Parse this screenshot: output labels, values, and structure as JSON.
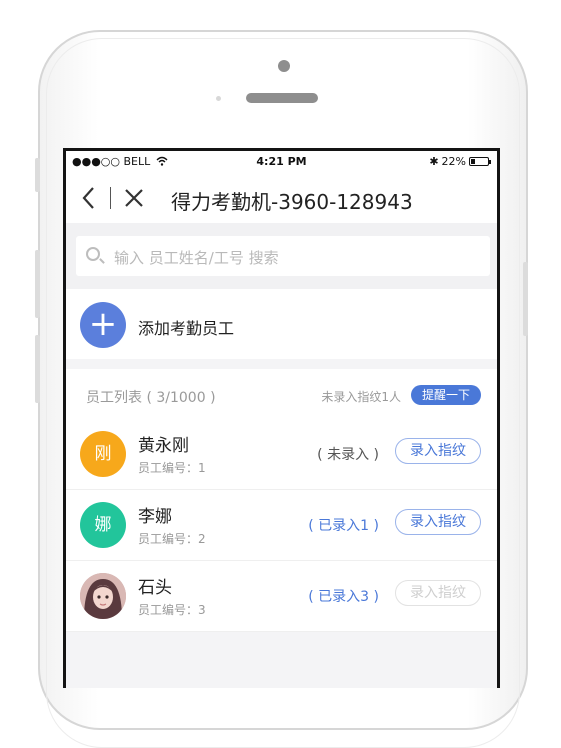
{
  "status_bar": {
    "carrier": "●●●○○ BELL",
    "time": "4:21 PM",
    "bluetooth": "✱",
    "battery_text": "22%",
    "battery_level": 0.22
  },
  "nav": {
    "title": "得力考勤机-3960-128943"
  },
  "search": {
    "placeholder": "输入 员工姓名/工号 搜索"
  },
  "add_employee": {
    "icon": "+",
    "label": "添加考勤员工"
  },
  "list_header": {
    "title": "员工列表 ( 3/1000 )",
    "unrecorded_text": "未录入指纹1人",
    "remind_button": "提醒一下"
  },
  "employees": [
    {
      "avatar_char": "刚",
      "avatar_color": "#f7a81b",
      "name": "黄永刚",
      "emp_no": "员工编号：1",
      "status": "( 未录入 )",
      "status_color": "#555555",
      "button": "录入指纹",
      "button_enabled": true
    },
    {
      "avatar_char": "娜",
      "avatar_color": "#22c59b",
      "name": "李娜",
      "emp_no": "员工编号：2",
      "status": "( 已录入1 )",
      "status_color": "#4a78d8",
      "button": "录入指纹",
      "button_enabled": true
    },
    {
      "avatar_char": "",
      "avatar_color": "#c9a7a7",
      "name": "石头",
      "emp_no": "员工编号：3",
      "status": "( 已录入3 )",
      "status_color": "#4a78d8",
      "button": "录入指纹",
      "button_enabled": false
    }
  ],
  "icons": [
    "back-icon",
    "close-icon",
    "search-icon",
    "plus-icon",
    "wifi-icon",
    "bluetooth-icon",
    "battery-icon"
  ]
}
